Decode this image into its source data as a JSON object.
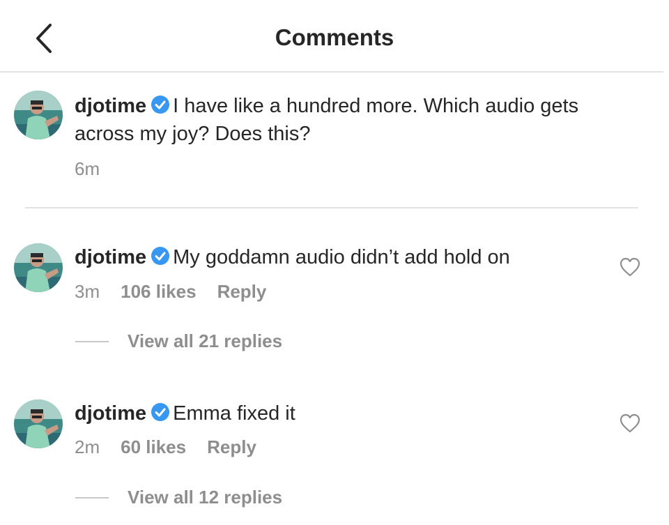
{
  "header": {
    "title": "Comments"
  },
  "caption": {
    "username": "djotime",
    "text": "I have like a hundred more. Which audio gets across my joy? Does this?",
    "time": "6m"
  },
  "comments": [
    {
      "username": "djotime",
      "text": "My goddamn audio didn’t add hold on",
      "time": "3m",
      "likes": "106 likes",
      "reply": "Reply",
      "view_replies": "View all 21 replies"
    },
    {
      "username": "djotime",
      "text": "Emma fixed it",
      "time": "2m",
      "likes": "60 likes",
      "reply": "Reply",
      "view_replies": "View all 12 replies"
    }
  ],
  "icons": {
    "back": "chevron-left-icon",
    "verified": "verified-badge-icon",
    "like": "heart-outline-icon"
  },
  "colors": {
    "verified": "#3897f0",
    "secondary_text": "#8e8e8e",
    "primary_text": "#262626"
  }
}
